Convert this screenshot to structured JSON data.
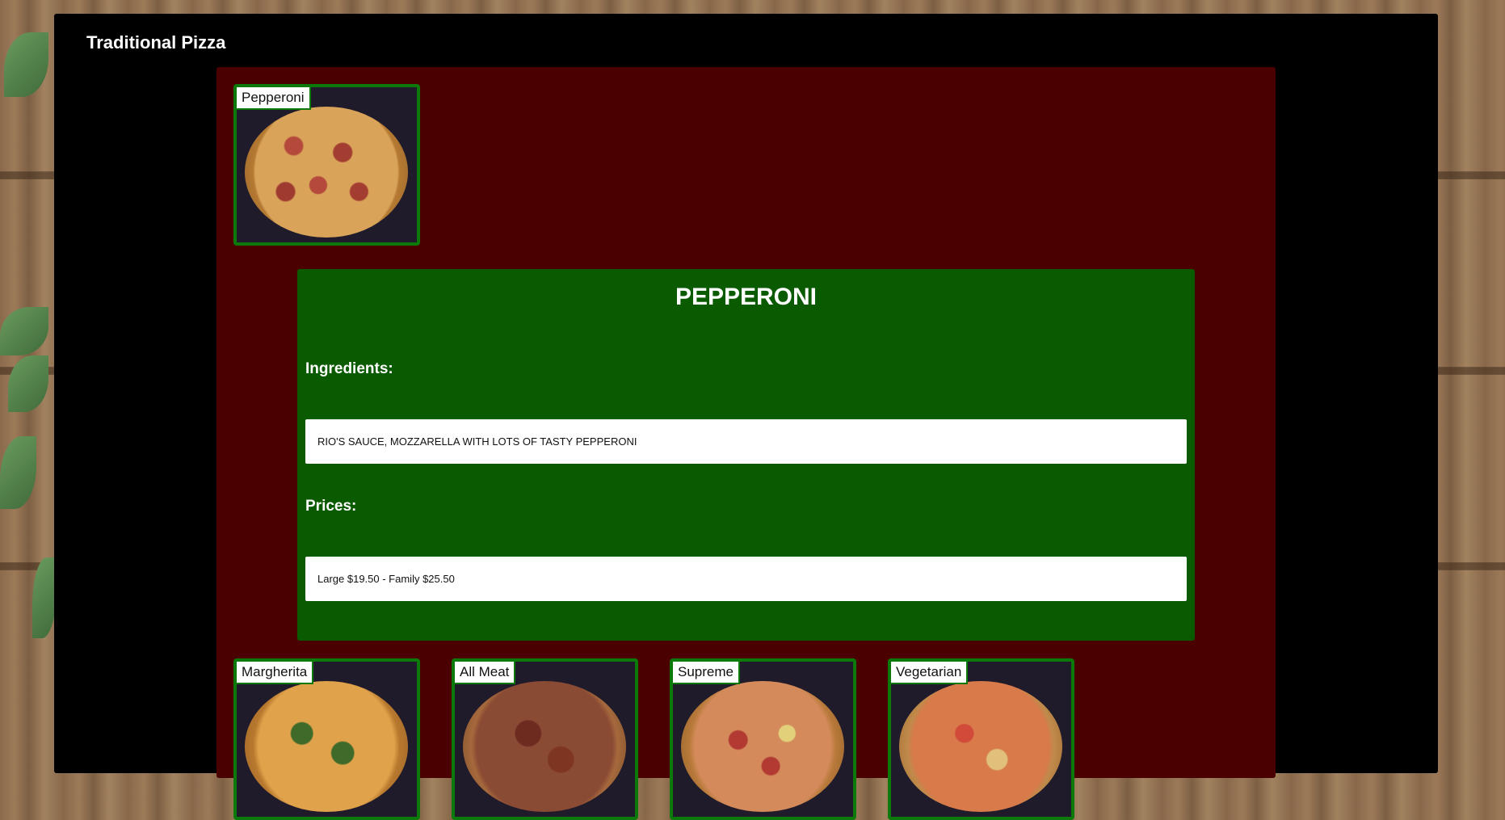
{
  "page": {
    "title": "Traditional Pizza"
  },
  "featured": {
    "label": "Pepperoni"
  },
  "detail": {
    "name": "PEPPERONI",
    "ingredients_label": "Ingredients:",
    "ingredients": "RIO'S SAUCE, MOZZARELLA WITH LOTS OF TASTY PEPPERONI",
    "prices_label": "Prices:",
    "prices": "Large $19.50 - Family $25.50"
  },
  "menu": [
    {
      "label": "Margherita"
    },
    {
      "label": "All Meat"
    },
    {
      "label": "Supreme"
    },
    {
      "label": "Vegetarian"
    }
  ],
  "colors": {
    "panel": "#000000",
    "inner": "#4a0000",
    "detail": "#0a5a00",
    "card_border": "#0b7a0b"
  }
}
